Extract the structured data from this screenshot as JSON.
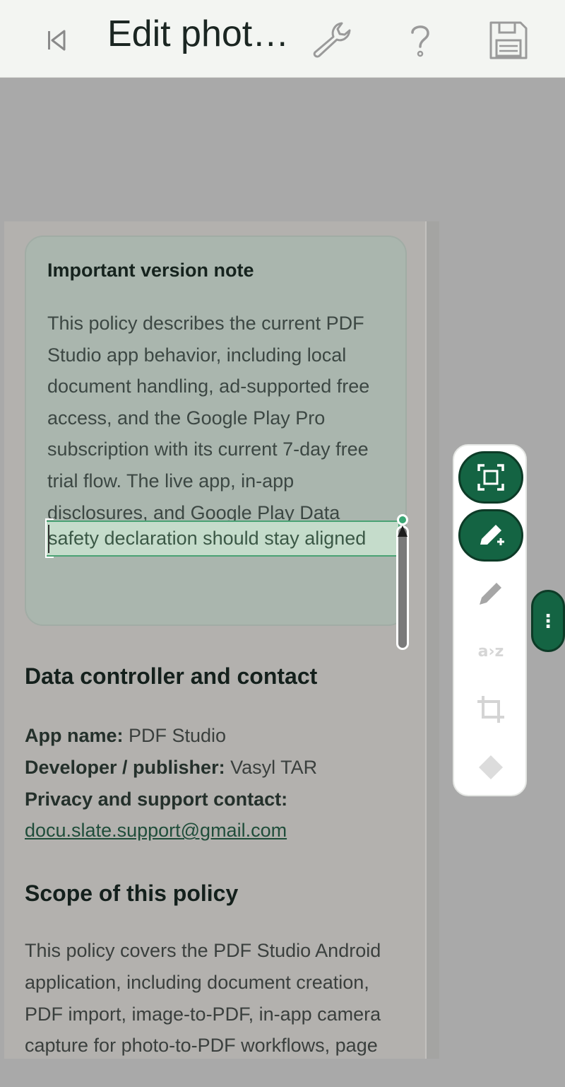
{
  "topbar": {
    "title": "Edit phot…",
    "icons": [
      "skip-back-icon",
      "wrench-icon",
      "help-icon",
      "save-icon"
    ]
  },
  "note": {
    "title": "Important version note",
    "lines": [
      "This policy describes the current PDF",
      "Studio app behavior, including local",
      "document handling, ad-supported free",
      "access, and the Google Play Pro",
      "subscription with its current 7-day free",
      "trial flow. The live app, in-app",
      "disclosures, and Google Play Data"
    ],
    "selected_line": "safety declaration should stay aligned"
  },
  "controller": {
    "heading": "Data controller and contact",
    "app_name_label": "App name:",
    "app_name_value": " PDF Studio",
    "developer_label": "Developer / publisher:",
    "developer_value": " Vasyl TAR",
    "contact_label": "Privacy and support contact:",
    "contact_email": "docu.slate.support@gmail.com"
  },
  "scope": {
    "heading": "Scope of this policy",
    "lines": [
      "This policy covers the PDF Studio Android",
      "application, including document creation,",
      "PDF import, image-to-PDF, in-app camera",
      "capture for photo-to-PDF workflows, page"
    ]
  },
  "palette": {
    "text_tool_label": "a›z",
    "tools": [
      "select-area-icon",
      "add-text-icon",
      "pencil-icon",
      "text-replace-icon",
      "crop-icon",
      "shape-icon"
    ]
  },
  "side_handle": {
    "label": "⋮"
  },
  "colors": {
    "accent": "#146443",
    "selection": "#c5dccb",
    "topbar": "#f3f5f2"
  }
}
